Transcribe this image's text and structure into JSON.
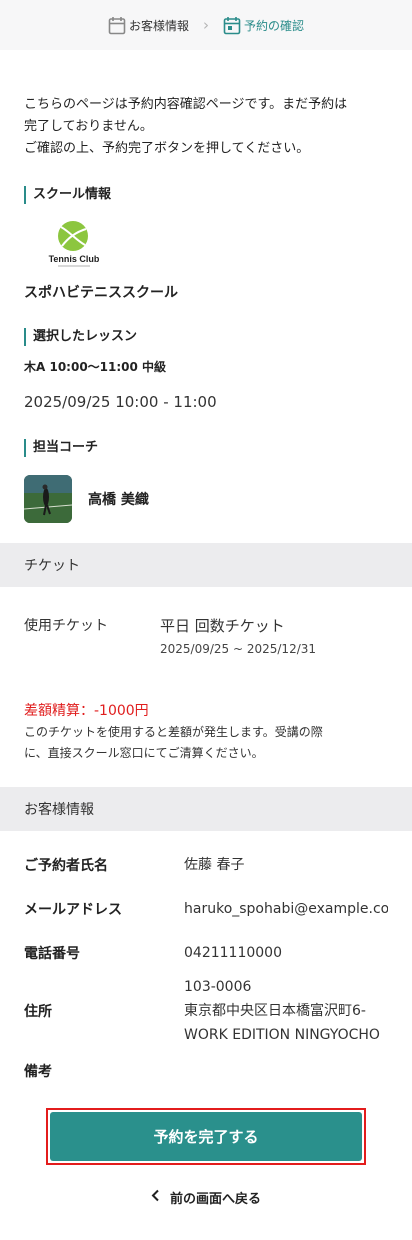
{
  "steps": [
    {
      "label": "お客様情報",
      "icon": "calendar-icon",
      "active": false
    },
    {
      "label": "予約の確認",
      "icon": "calendar-check-icon",
      "active": true
    }
  ],
  "intro": {
    "line1": "こちらのページは予約内容確認ページです。まだ予約は",
    "line2": "完了しておりません。",
    "line3": "ご確認の上、予約完了ボタンを押してください。"
  },
  "school": {
    "heading": "スクール情報",
    "logo_text": "Tennis Club",
    "name": "スポハビテニススクール"
  },
  "lesson": {
    "heading": "選択したレッスン",
    "name": "木A 10:00〜11:00 中級",
    "datetime": "2025/09/25 10:00 - 11:00"
  },
  "coach": {
    "heading": "担当コーチ",
    "name": "高橋 美織"
  },
  "ticket": {
    "band_title": "チケット",
    "label": "使用チケット",
    "name": "平日 回数チケット",
    "period": "2025/09/25 ~ 2025/12/31",
    "diff_title": "差額精算：-1000円",
    "diff_line1": "このチケットを使用すると差額が発生します。受講の際",
    "diff_line2": "に、直接スクール窓口にてご清算ください。"
  },
  "customer": {
    "band_title": "お客様情報",
    "name_label": "ご予約者氏名",
    "name_value": "佐藤 春子",
    "email_label": "メールアドレス",
    "email_value": "haruko_spohabi@example.com",
    "phone_label": "電話番号",
    "phone_value": "04211110000",
    "address_label": "住所",
    "address_zip": "103-0006",
    "address_line1": "東京都中央区日本橋富沢町6-",
    "address_line2": "WORK EDITION NINGYOCHO",
    "note_label": "備考"
  },
  "actions": {
    "complete_label": "予約を完了する",
    "back_label": "前の画面へ戻る"
  },
  "colors": {
    "accent": "#2a908c",
    "warning": "#e01e1e",
    "logo_green": "#8cc63f"
  }
}
